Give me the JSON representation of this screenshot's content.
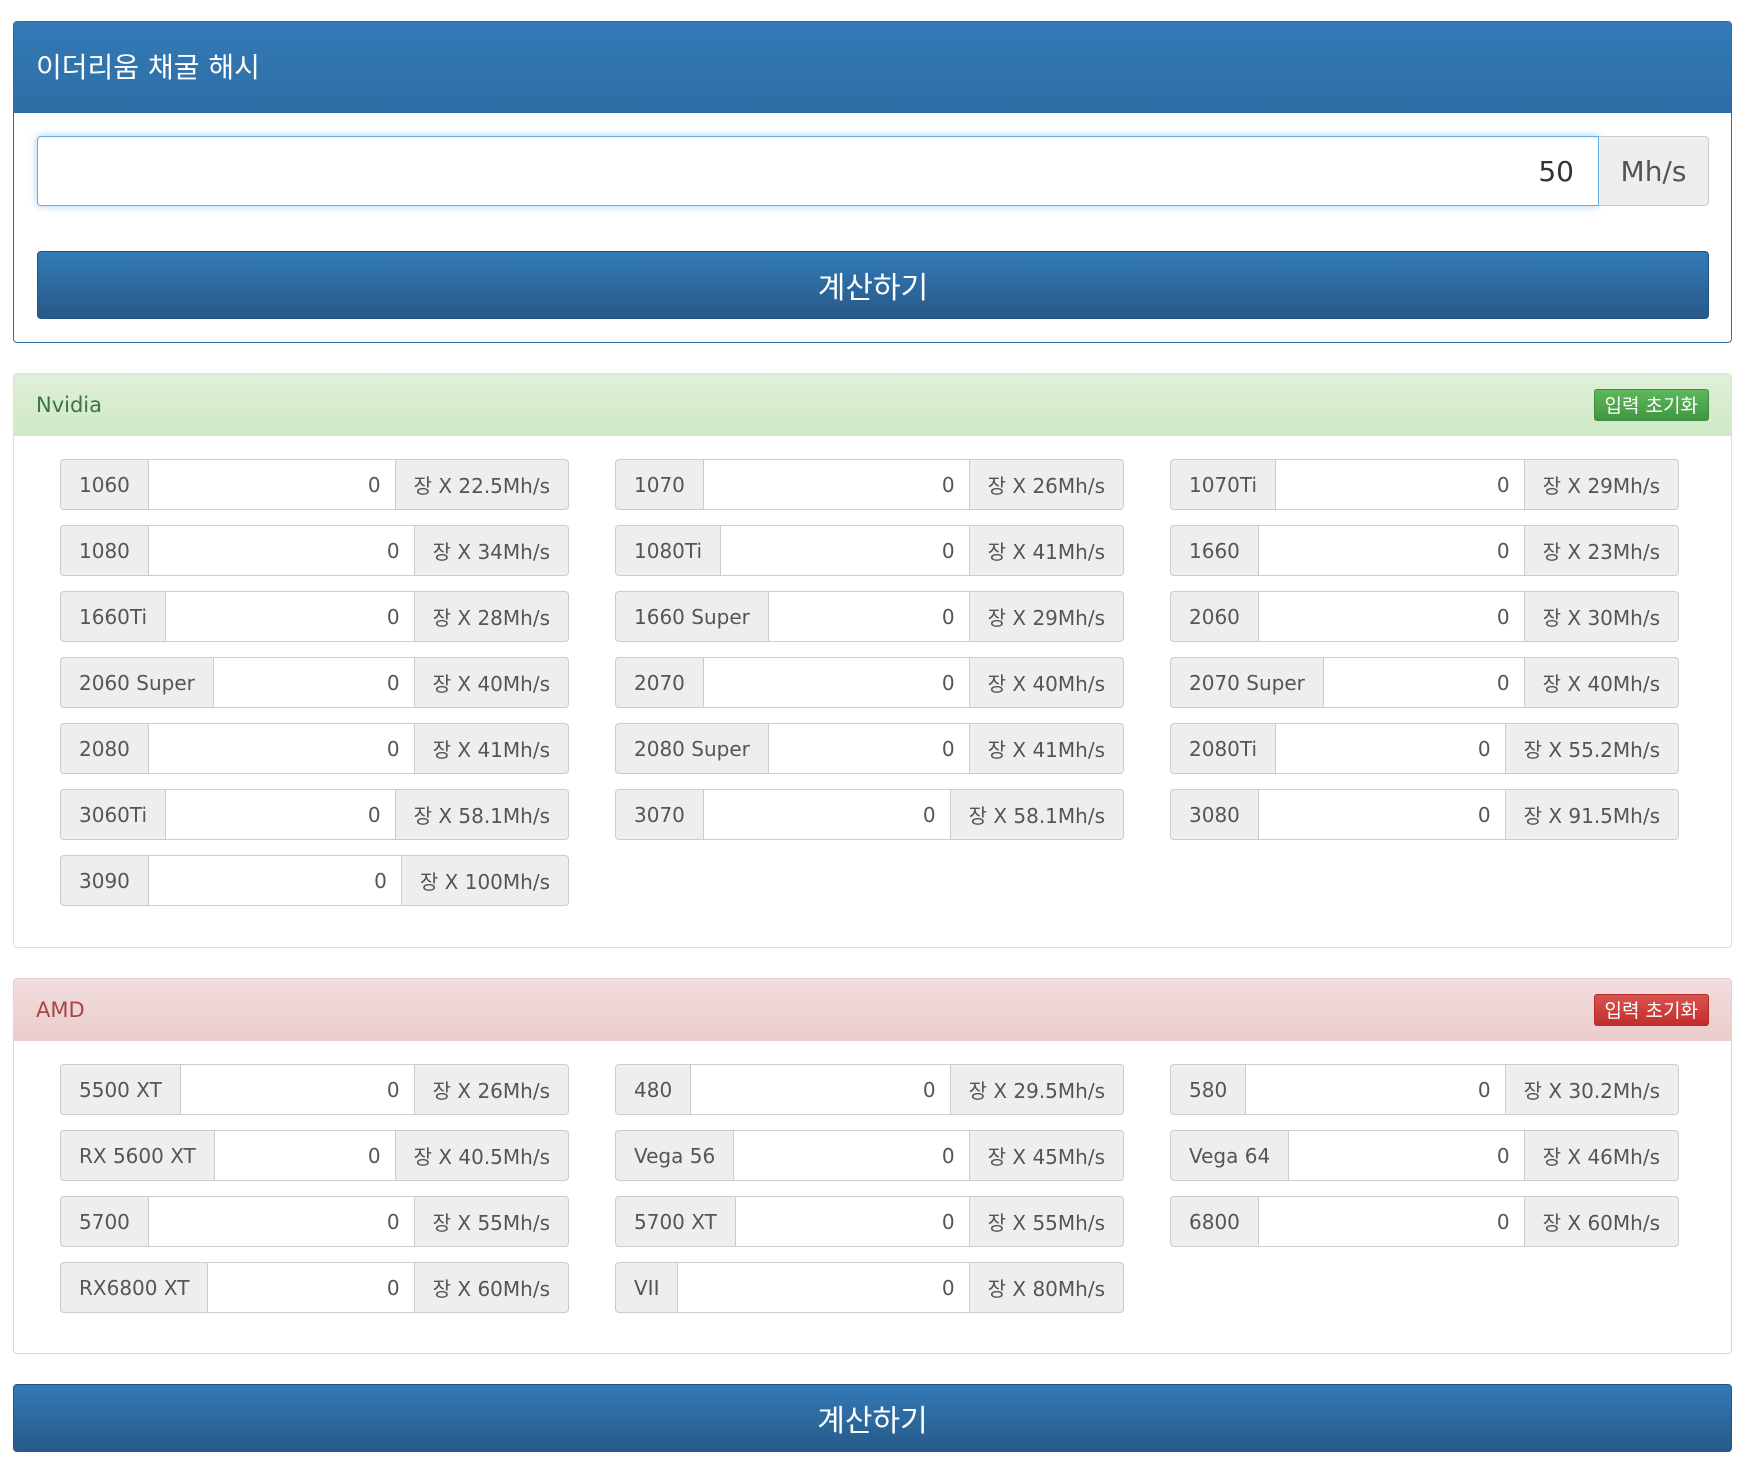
{
  "hash": {
    "title": "이더리움 채굴 해시",
    "value": "50",
    "unit": "Mh/s",
    "calc_label": "계산하기"
  },
  "nvidia": {
    "title": "Nvidia",
    "reset_label": "입력 초기화",
    "gpus": [
      {
        "name": "1060",
        "value": "0",
        "rate": "장 X 22.5Mh/s"
      },
      {
        "name": "1070",
        "value": "0",
        "rate": "장 X 26Mh/s"
      },
      {
        "name": "1070Ti",
        "value": "0",
        "rate": "장 X 29Mh/s"
      },
      {
        "name": "1080",
        "value": "0",
        "rate": "장 X 34Mh/s"
      },
      {
        "name": "1080Ti",
        "value": "0",
        "rate": "장 X 41Mh/s"
      },
      {
        "name": "1660",
        "value": "0",
        "rate": "장 X 23Mh/s"
      },
      {
        "name": "1660Ti",
        "value": "0",
        "rate": "장 X 28Mh/s"
      },
      {
        "name": "1660 Super",
        "value": "0",
        "rate": "장 X 29Mh/s"
      },
      {
        "name": "2060",
        "value": "0",
        "rate": "장 X 30Mh/s"
      },
      {
        "name": "2060 Super",
        "value": "0",
        "rate": "장 X 40Mh/s"
      },
      {
        "name": "2070",
        "value": "0",
        "rate": "장 X 40Mh/s"
      },
      {
        "name": "2070 Super",
        "value": "0",
        "rate": "장 X 40Mh/s"
      },
      {
        "name": "2080",
        "value": "0",
        "rate": "장 X 41Mh/s"
      },
      {
        "name": "2080 Super",
        "value": "0",
        "rate": "장 X 41Mh/s"
      },
      {
        "name": "2080Ti",
        "value": "0",
        "rate": "장 X 55.2Mh/s"
      },
      {
        "name": "3060Ti",
        "value": "0",
        "rate": "장 X 58.1Mh/s"
      },
      {
        "name": "3070",
        "value": "0",
        "rate": "장 X 58.1Mh/s"
      },
      {
        "name": "3080",
        "value": "0",
        "rate": "장 X 91.5Mh/s"
      },
      {
        "name": "3090",
        "value": "0",
        "rate": "장 X 100Mh/s"
      }
    ]
  },
  "amd": {
    "title": "AMD",
    "reset_label": "입력 초기화",
    "gpus": [
      {
        "name": "5500 XT",
        "value": "0",
        "rate": "장 X 26Mh/s"
      },
      {
        "name": "480",
        "value": "0",
        "rate": "장 X 29.5Mh/s"
      },
      {
        "name": "580",
        "value": "0",
        "rate": "장 X 30.2Mh/s"
      },
      {
        "name": "RX 5600 XT",
        "value": "0",
        "rate": "장 X 40.5Mh/s"
      },
      {
        "name": "Vega 56",
        "value": "0",
        "rate": "장 X 45Mh/s"
      },
      {
        "name": "Vega 64",
        "value": "0",
        "rate": "장 X 46Mh/s"
      },
      {
        "name": "5700",
        "value": "0",
        "rate": "장 X 55Mh/s"
      },
      {
        "name": "5700 XT",
        "value": "0",
        "rate": "장 X 55Mh/s"
      },
      {
        "name": "6800",
        "value": "0",
        "rate": "장 X 60Mh/s"
      },
      {
        "name": "RX6800 XT",
        "value": "0",
        "rate": "장 X 60Mh/s"
      },
      {
        "name": "VII",
        "value": "0",
        "rate": "장 X 80Mh/s"
      }
    ]
  },
  "footer": {
    "calc_label": "계산하기"
  }
}
